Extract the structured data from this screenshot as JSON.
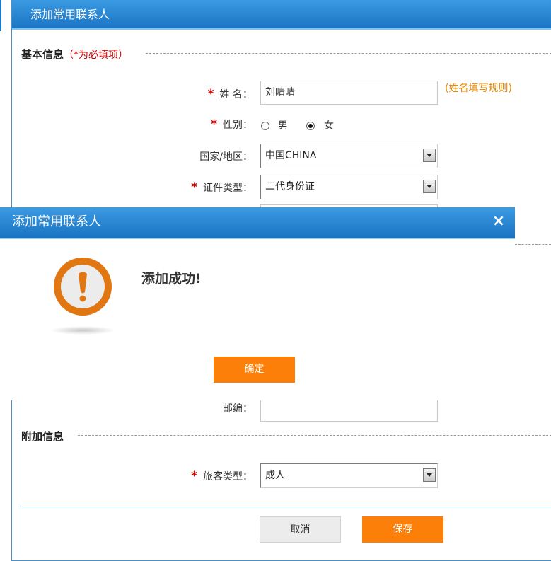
{
  "window": {
    "title": "添加常用联系人"
  },
  "basic_info": {
    "section_title": "基本信息",
    "required_hint": "（*为必填项）",
    "name": {
      "required": "*",
      "label": "姓 名：",
      "value": "刘晴晴",
      "rule_link": "(姓名填写规则)"
    },
    "gender": {
      "required": "*",
      "label": "性别：",
      "options": [
        "男",
        "女"
      ],
      "selected": "女"
    },
    "country": {
      "label": "国家/地区：",
      "value": "中国CHINA"
    },
    "id_type": {
      "required": "*",
      "label": "证件类型：",
      "value": "二代身份证"
    },
    "postcode": {
      "label": "邮编：",
      "value": ""
    }
  },
  "extra_info": {
    "section_title": "附加信息",
    "passenger_type": {
      "required": "*",
      "label": "旅客类型：",
      "value": "成人"
    }
  },
  "buttons": {
    "cancel": "取消",
    "save": "保存"
  },
  "dialog": {
    "title": "添加常用联系人",
    "close": "×",
    "message": "添加成功!",
    "icon": "warning-exclamation-icon",
    "confirm": "确定"
  },
  "colors": {
    "title_bar": "#1b75c4",
    "accent_orange": "#fb7f09",
    "required_red": "#d40000",
    "link_orange": "#e58a00",
    "icon_orange": "#e07712"
  }
}
